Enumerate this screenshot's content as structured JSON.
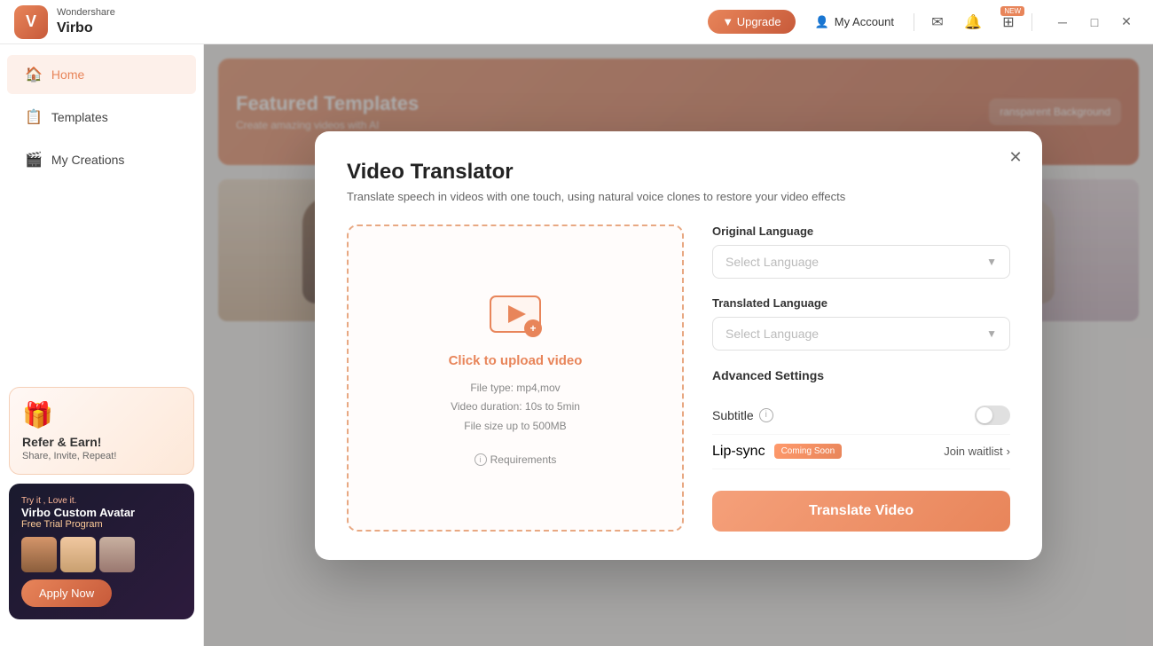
{
  "app": {
    "logo_name": "Wondershare",
    "logo_product": "Virbo",
    "logo_icon": "V"
  },
  "titlebar": {
    "upgrade_label": "▼ Upgrade",
    "my_account_label": "My Account",
    "new_badge": "NEW",
    "icon_mail": "✉",
    "icon_bell": "🔔",
    "icon_grid": "⊞",
    "win_minimize": "─",
    "win_restore": "□",
    "win_close": "✕"
  },
  "sidebar": {
    "home_label": "Home",
    "templates_label": "Templates",
    "my_creations_label": "My Creations",
    "promo1_title": "Refer & Earn!",
    "promo1_sub": "Share, Invite, Repeat!",
    "promo2_try": "Try it , Love it.",
    "promo2_title": "Virbo Custom Avatar",
    "promo2_free": "Free Trial Program",
    "apply_btn": "Apply Now"
  },
  "background": {
    "transparent_bg": "ransparent Background",
    "hero_text": "",
    "promo_badge": "🎯"
  },
  "modal": {
    "title": "Video Translator",
    "subtitle": "Translate speech in videos with one touch, using natural voice clones to restore your video effects",
    "close_label": "✕",
    "upload_click_text": "Click to upload video",
    "upload_info_line1": "File type: mp4,mov",
    "upload_info_line2": "Video duration: 10s to  5min",
    "upload_info_line3": "File size up to  500MB",
    "upload_req_label": "Requirements",
    "original_lang_label": "Original Language",
    "translated_lang_label": "Translated Language",
    "select_lang_placeholder": "Select Language",
    "advanced_settings_label": "Advanced Settings",
    "subtitle_label": "Subtitle",
    "lipsync_label": "Lip-sync",
    "coming_soon_badge": "Coming Soon",
    "join_waitlist_label": "Join waitlist",
    "join_waitlist_arrow": "›",
    "translate_btn_label": "Translate Video"
  }
}
